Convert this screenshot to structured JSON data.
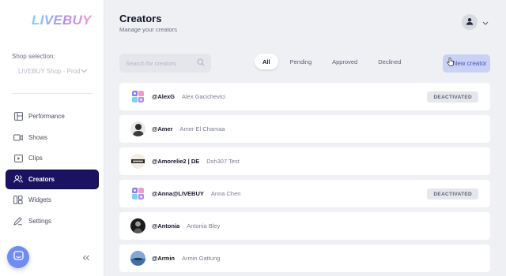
{
  "brand": {
    "logo_text": "LIVEBUY"
  },
  "shop": {
    "label": "Shop selection:",
    "selected": "LIVEBUY Shop - Prod"
  },
  "nav": [
    {
      "label": "Performance",
      "icon": "layout-icon"
    },
    {
      "label": "Shows",
      "icon": "video-icon"
    },
    {
      "label": "Clips",
      "icon": "play-square-icon"
    },
    {
      "label": "Creators",
      "icon": "users-icon",
      "active": true
    },
    {
      "label": "Widgets",
      "icon": "widgets-icon"
    },
    {
      "label": "Settings",
      "icon": "pen-icon"
    }
  ],
  "header": {
    "title": "Creators",
    "subtitle": "Manage your creators"
  },
  "search": {
    "placeholder": "Search for creators"
  },
  "tabs": [
    {
      "label": "All",
      "active": true
    },
    {
      "label": "Pending"
    },
    {
      "label": "Approved"
    },
    {
      "label": "Declined"
    }
  ],
  "new_creator_label": "New creator",
  "creators": [
    {
      "handle": "@AlexG",
      "name": "Alex Gacichevici",
      "status": "DEACTIVATED",
      "avatar": "logo"
    },
    {
      "handle": "@Amer",
      "name": "Amer El Chamaa",
      "status": "",
      "avatar": "photo-dark"
    },
    {
      "handle": "@Amorelie2 | DE",
      "name": "Dsh307 Test",
      "status": "",
      "avatar": "photo-brand"
    },
    {
      "handle": "@Anna@LIVEBUY",
      "name": "Anna Chen",
      "status": "DEACTIVATED",
      "avatar": "logo"
    },
    {
      "handle": "@Antonia",
      "name": "Antonia Bley",
      "status": "",
      "avatar": "photo-bw"
    },
    {
      "handle": "@Armin",
      "name": "Armin Gattung",
      "status": "",
      "avatar": "photo-sky"
    }
  ],
  "colors": {
    "accent": "#1b1262",
    "new_button_bg": "#c9d2f6",
    "chat_button": "#6f8df0"
  }
}
